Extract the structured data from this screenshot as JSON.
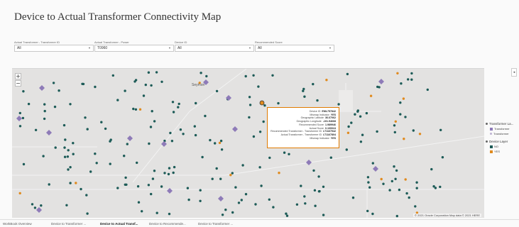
{
  "page": {
    "title": "Device to Actual Transformer Connectivity Map"
  },
  "filters": [
    {
      "label": "Actual Transformer - Transformer ID",
      "value": "All"
    },
    {
      "label": "Actual Transformer - Power",
      "value": "T0960"
    },
    {
      "label": "Device ID",
      "value": "All"
    },
    {
      "label": "Recommended Score",
      "value": "All"
    }
  ],
  "map": {
    "zoom_in": "+",
    "zoom_out": "−",
    "city_label": "Seymon",
    "credit": "© 2021 Oracle Corporation   Map data © 2021 HERE",
    "colors": {
      "background": "#e3e2e1",
      "device_no": "#1d5b57",
      "device_yes": "#e08a1e",
      "transformer": "#8e7bb8"
    }
  },
  "tooltip": {
    "rows": [
      {
        "key": "Device ID",
        "value": "EML757842"
      },
      {
        "key": "Mismap Indicator",
        "value": "YES"
      },
      {
        "key": "Geographic Latitude",
        "value": "36.67062"
      },
      {
        "key": "Geographic Longitude",
        "value": "-101.54668"
      },
      {
        "key": "Recommended Score",
        "value": "1.989946"
      },
      {
        "key": "Actual Score",
        "value": "0.100024"
      },
      {
        "key": "Recommended Transformer - Transformer ID",
        "value": "LT1167942"
      },
      {
        "key": "Actual Transformer - Transformer ID",
        "value": "LT1167804"
      },
      {
        "key": "Mismap Indicator",
        "value": "YES"
      }
    ]
  },
  "legend": {
    "toggle_icon": "◂",
    "transformer_layer": {
      "title": "Transformer La...",
      "items": [
        {
          "label": "Transformer",
          "color": "#8e7bb8"
        },
        {
          "label": "Transformer",
          "color": "#bdb3d3"
        }
      ]
    },
    "device_layer": {
      "title": "Device Layer",
      "items": [
        {
          "label": "NO",
          "color": "#1d5b57"
        },
        {
          "label": "YES",
          "color": "#e08a1e"
        }
      ]
    }
  },
  "tabs": [
    {
      "label": "WorkBook Overview",
      "active": false
    },
    {
      "label": "Device to Transformer ...",
      "active": false
    },
    {
      "label": "Device to Actual Transf...",
      "active": true
    },
    {
      "label": "Device to Recommende...",
      "active": false
    },
    {
      "label": "Device to Transformer ...",
      "active": false
    }
  ]
}
